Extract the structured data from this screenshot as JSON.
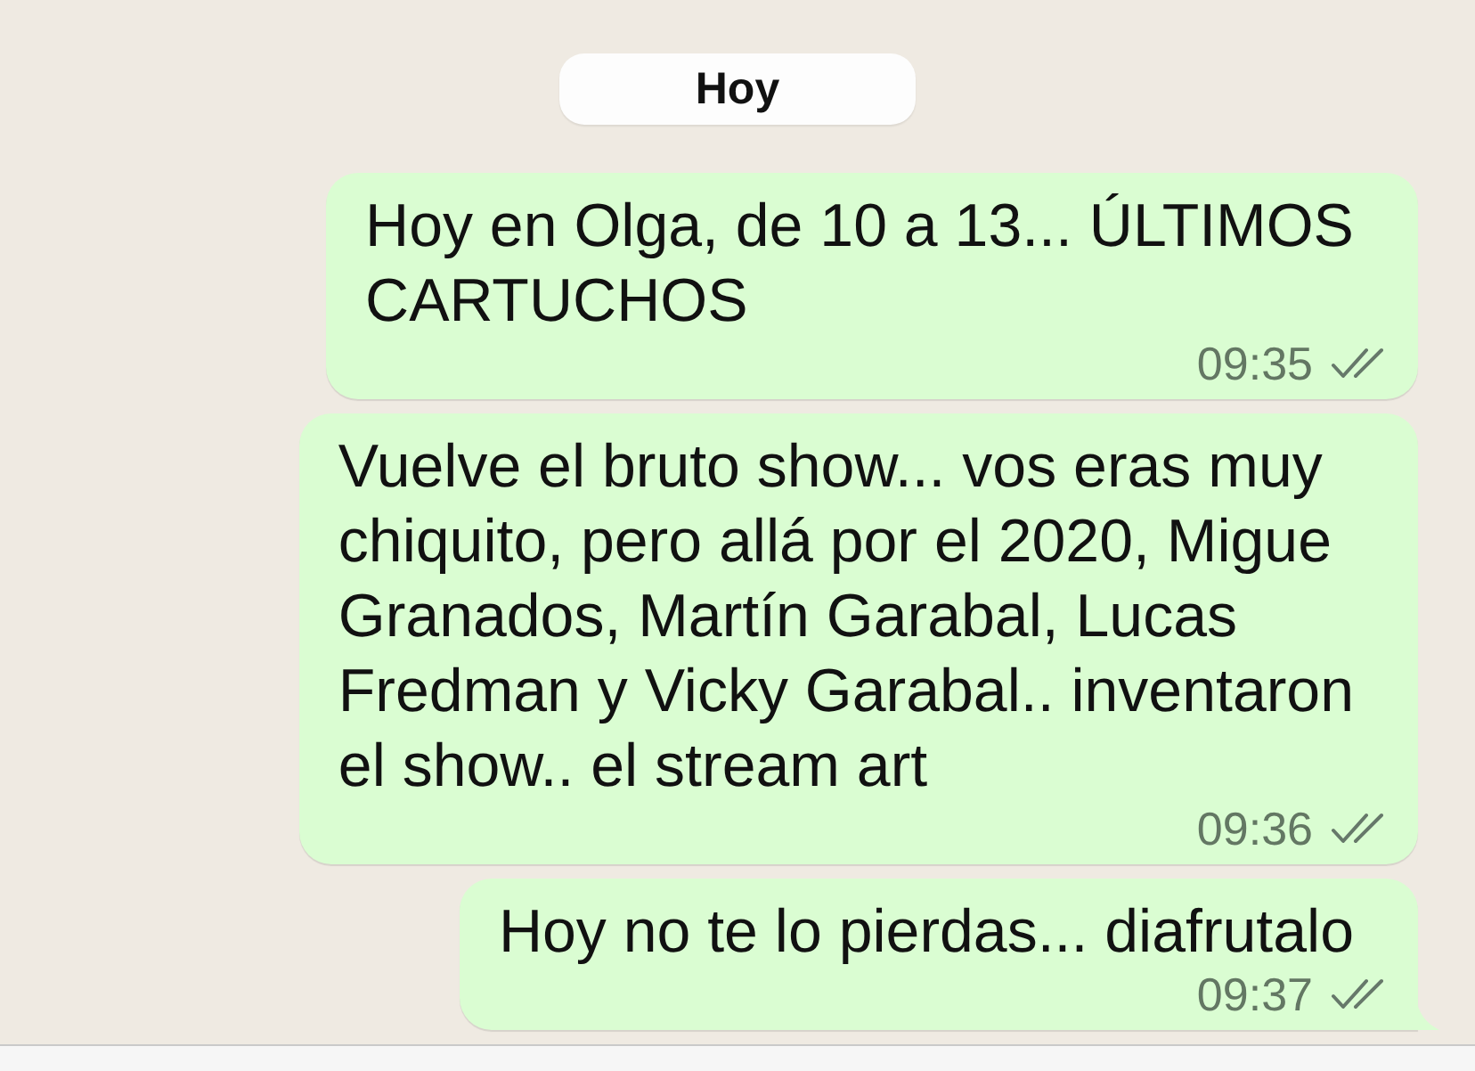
{
  "date_badge": "Hoy",
  "messages": [
    {
      "text": "Hoy en Olga, de 10 a 13... ÚLTIMOS\nCARTUCHOS",
      "time": "09:35",
      "read": false,
      "tail": false
    },
    {
      "text": "Vuelve el bruto show... vos eras muy\nchiquito, pero allá por el 2020, Migue\nGranados, Martín Garabal, Lucas\nFredman y Vicky Garabal.. inventaron\nel show.. el stream art",
      "time": "09:36",
      "read": false,
      "tail": false
    },
    {
      "text": "Hoy no te lo pierdas... diafrutalo",
      "time": "09:37",
      "read": false,
      "tail": true
    }
  ]
}
